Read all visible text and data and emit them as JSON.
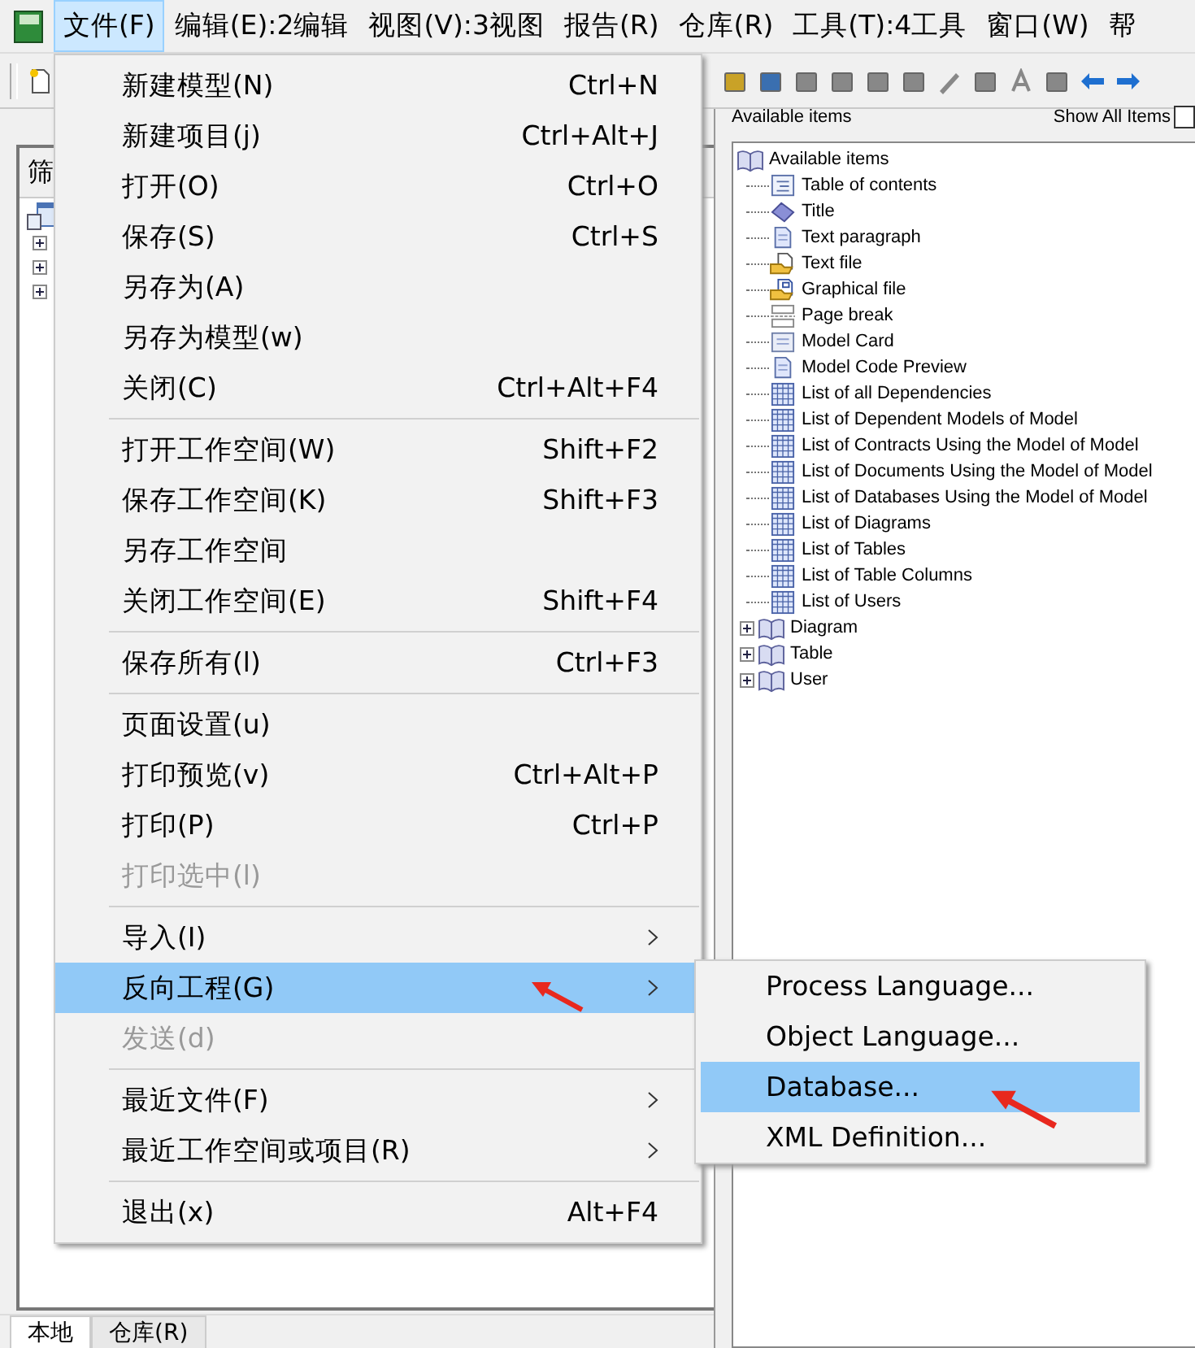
{
  "menubar": [
    {
      "label": "文件(F)",
      "selected": true
    },
    {
      "label": "编辑(E):2编辑",
      "selected": false
    },
    {
      "label": "视图(V):3视图",
      "selected": false
    },
    {
      "label": "报告(R)",
      "selected": false
    },
    {
      "label": "仓库(R)",
      "selected": false
    },
    {
      "label": "工具(T):4工具",
      "selected": false
    },
    {
      "label": "窗口(W)",
      "selected": false
    },
    {
      "label": "帮",
      "selected": false
    }
  ],
  "left_pane": {
    "tab_label": "筛",
    "tree": [
      {
        "expanded": false
      },
      {
        "expanded": false
      },
      {
        "expanded": false
      }
    ],
    "bottom_tabs": [
      {
        "label": "本地",
        "selected": true
      },
      {
        "label": "仓库(R)",
        "selected": false
      }
    ]
  },
  "right_pane": {
    "title": "Available items",
    "show_all": {
      "label": "Show All Items",
      "checked": false
    },
    "tree": {
      "label": "Available items",
      "kind": "book",
      "expanded": true,
      "children": [
        {
          "label": "Table of contents",
          "kind": "toc"
        },
        {
          "label": "Title",
          "kind": "title"
        },
        {
          "label": "Text paragraph",
          "kind": "paragraph"
        },
        {
          "label": "Text file",
          "kind": "textfile"
        },
        {
          "label": "Graphical file",
          "kind": "graphic"
        },
        {
          "label": "Page break",
          "kind": "pagebreak"
        },
        {
          "label": "Model Card",
          "kind": "card"
        },
        {
          "label": "Model Code Preview",
          "kind": "paragraph"
        },
        {
          "label": "List of all Dependencies",
          "kind": "list"
        },
        {
          "label": "List of Dependent Models of Model",
          "kind": "list"
        },
        {
          "label": "List of Contracts Using the Model of Model",
          "kind": "list"
        },
        {
          "label": "List of Documents Using the Model of Model",
          "kind": "list"
        },
        {
          "label": "List of Databases Using the Model of Model",
          "kind": "list"
        },
        {
          "label": "List of Diagrams",
          "kind": "list"
        },
        {
          "label": "List of Tables",
          "kind": "list"
        },
        {
          "label": "List of Table Columns",
          "kind": "list"
        },
        {
          "label": "List of Users",
          "kind": "list"
        }
      ]
    },
    "groups": [
      {
        "label": "Diagram",
        "kind": "book",
        "expanded": false
      },
      {
        "label": "Table",
        "kind": "book",
        "expanded": false
      },
      {
        "label": "User",
        "kind": "book",
        "expanded": false
      }
    ]
  },
  "file_menu": [
    {
      "kind": "item",
      "label": "新建模型(N)",
      "shortcut": "Ctrl+N",
      "disabled": false,
      "submenu": false,
      "selected": false,
      "marked": false
    },
    {
      "kind": "item",
      "label": "新建项目(j)",
      "shortcut": "Ctrl+Alt+J",
      "disabled": false,
      "submenu": false,
      "selected": false,
      "marked": false
    },
    {
      "kind": "item",
      "label": "打开(O)",
      "shortcut": "Ctrl+O",
      "disabled": false,
      "submenu": false,
      "selected": false,
      "marked": false
    },
    {
      "kind": "item",
      "label": "保存(S)",
      "shortcut": "Ctrl+S",
      "disabled": false,
      "submenu": false,
      "selected": false,
      "marked": false
    },
    {
      "kind": "item",
      "label": "另存为(A)",
      "disabled": false,
      "submenu": false,
      "selected": false,
      "marked": false
    },
    {
      "kind": "item",
      "label": "另存为模型(w)",
      "disabled": false,
      "submenu": false,
      "selected": false,
      "marked": false
    },
    {
      "kind": "item",
      "label": "关闭(C)",
      "shortcut": "Ctrl+Alt+F4",
      "disabled": false,
      "submenu": false,
      "selected": false,
      "marked": false
    },
    {
      "kind": "separator"
    },
    {
      "kind": "item",
      "label": "打开工作空间(W)",
      "shortcut": "Shift+F2",
      "disabled": false,
      "submenu": false,
      "selected": false,
      "marked": false
    },
    {
      "kind": "item",
      "label": "保存工作空间(K)",
      "shortcut": "Shift+F3",
      "disabled": false,
      "submenu": false,
      "selected": false,
      "marked": false
    },
    {
      "kind": "item",
      "label": "另存工作空间",
      "disabled": false,
      "submenu": false,
      "selected": false,
      "marked": false
    },
    {
      "kind": "item",
      "label": "关闭工作空间(E)",
      "shortcut": "Shift+F4",
      "disabled": false,
      "submenu": false,
      "selected": false,
      "marked": false
    },
    {
      "kind": "separator"
    },
    {
      "kind": "item",
      "label": "保存所有(l)",
      "shortcut": "Ctrl+F3",
      "disabled": false,
      "submenu": false,
      "selected": false,
      "marked": false
    },
    {
      "kind": "separator"
    },
    {
      "kind": "item",
      "label": "页面设置(u)",
      "disabled": false,
      "submenu": false,
      "selected": false,
      "marked": false
    },
    {
      "kind": "item",
      "label": "打印预览(v)",
      "shortcut": "Ctrl+Alt+P",
      "disabled": false,
      "submenu": false,
      "selected": false,
      "marked": false
    },
    {
      "kind": "item",
      "label": "打印(P)",
      "shortcut": "Ctrl+P",
      "disabled": false,
      "submenu": false,
      "selected": false,
      "marked": false
    },
    {
      "kind": "item",
      "label": "打印选中(l)",
      "disabled": true,
      "submenu": false,
      "selected": false,
      "marked": false
    },
    {
      "kind": "separator"
    },
    {
      "kind": "item",
      "label": "导入(I)",
      "disabled": false,
      "submenu": true,
      "selected": false,
      "marked": false
    },
    {
      "kind": "item",
      "label": "反向工程(G)",
      "disabled": false,
      "submenu": true,
      "selected": true,
      "marked": true
    },
    {
      "kind": "item",
      "label": "发送(d)",
      "disabled": true,
      "submenu": false,
      "selected": false,
      "marked": false
    },
    {
      "kind": "separator"
    },
    {
      "kind": "item",
      "label": "最近文件(F)",
      "disabled": false,
      "submenu": true,
      "selected": false,
      "marked": false
    },
    {
      "kind": "item",
      "label": "最近工作空间或项目(R)",
      "disabled": false,
      "submenu": true,
      "selected": false,
      "marked": false
    },
    {
      "kind": "separator"
    },
    {
      "kind": "item",
      "label": "退出(x)",
      "shortcut": "Alt+F4",
      "disabled": false,
      "submenu": false,
      "selected": false,
      "marked": false
    }
  ],
  "reverse_engineer_submenu": [
    {
      "label": "Process Language...",
      "selected": false,
      "marked": false
    },
    {
      "label": "Object Language...",
      "selected": false,
      "marked": false
    },
    {
      "label": "Database...",
      "selected": true,
      "marked": true
    },
    {
      "label": "XML Definition...",
      "selected": false,
      "marked": false
    }
  ]
}
